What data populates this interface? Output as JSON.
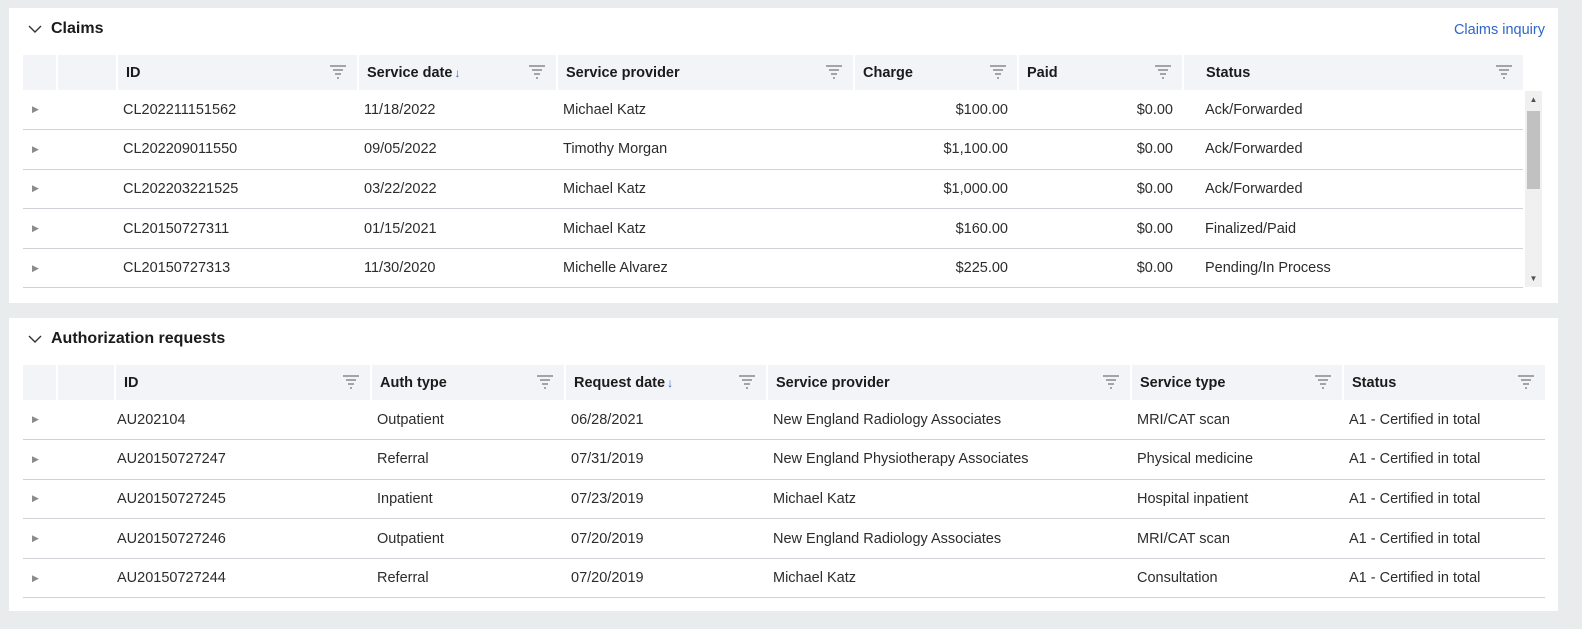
{
  "claims": {
    "title": "Claims",
    "link": "Claims inquiry",
    "columns": [
      "ID",
      "Service date",
      "Service provider",
      "Charge",
      "Paid",
      "Status"
    ],
    "sort_arrow": "↓",
    "rows": [
      {
        "id": "CL202211151562",
        "date": "11/18/2022",
        "provider": "Michael Katz",
        "charge": "$100.00",
        "paid": "$0.00",
        "status": "Ack/Forwarded"
      },
      {
        "id": "CL202209011550",
        "date": "09/05/2022",
        "provider": "Timothy Morgan",
        "charge": "$1,100.00",
        "paid": "$0.00",
        "status": "Ack/Forwarded"
      },
      {
        "id": "CL202203221525",
        "date": "03/22/2022",
        "provider": "Michael Katz",
        "charge": "$1,000.00",
        "paid": "$0.00",
        "status": "Ack/Forwarded"
      },
      {
        "id": "CL20150727311",
        "date": "01/15/2021",
        "provider": "Michael Katz",
        "charge": "$160.00",
        "paid": "$0.00",
        "status": "Finalized/Paid"
      },
      {
        "id": "CL20150727313",
        "date": "11/30/2020",
        "provider": "Michelle Alvarez",
        "charge": "$225.00",
        "paid": "$0.00",
        "status": "Pending/In Process"
      }
    ]
  },
  "auth": {
    "title": "Authorization requests",
    "columns": [
      "ID",
      "Auth type",
      "Request date",
      "Service provider",
      "Service type",
      "Status"
    ],
    "sort_arrow": "↓",
    "rows": [
      {
        "id": "AU202104",
        "type": "Outpatient",
        "date": "06/28/2021",
        "provider": "New England Radiology Associates",
        "service": "MRI/CAT scan",
        "status": "A1 - Certified in total"
      },
      {
        "id": "AU20150727247",
        "type": "Referral",
        "date": "07/31/2019",
        "provider": "New England Physiotherapy Associates",
        "service": "Physical medicine",
        "status": "A1 - Certified in total"
      },
      {
        "id": "AU20150727245",
        "type": "Inpatient",
        "date": "07/23/2019",
        "provider": "Michael Katz",
        "service": "Hospital inpatient",
        "status": "A1 - Certified in total"
      },
      {
        "id": "AU20150727246",
        "type": "Outpatient",
        "date": "07/20/2019",
        "provider": "New England Radiology Associates",
        "service": "MRI/CAT scan",
        "status": "A1 - Certified in total"
      },
      {
        "id": "AU20150727244",
        "type": "Referral",
        "date": "07/20/2019",
        "provider": "Michael Katz",
        "service": "Consultation",
        "status": "A1 - Certified in total"
      }
    ]
  },
  "icons": {
    "collapse": "chevron-down-icon",
    "filter": "filter-icon",
    "expand": "triangle-right-icon",
    "scroll_up": "triangle-up-icon",
    "scroll_down": "triangle-down-icon"
  },
  "colors": {
    "background": "#e8eced",
    "header_row": "#f3f4f8",
    "link": "#2f66c7"
  },
  "glyphs": {
    "expand": "▶",
    "scroll_up": "▲",
    "scroll_down": "▼"
  }
}
